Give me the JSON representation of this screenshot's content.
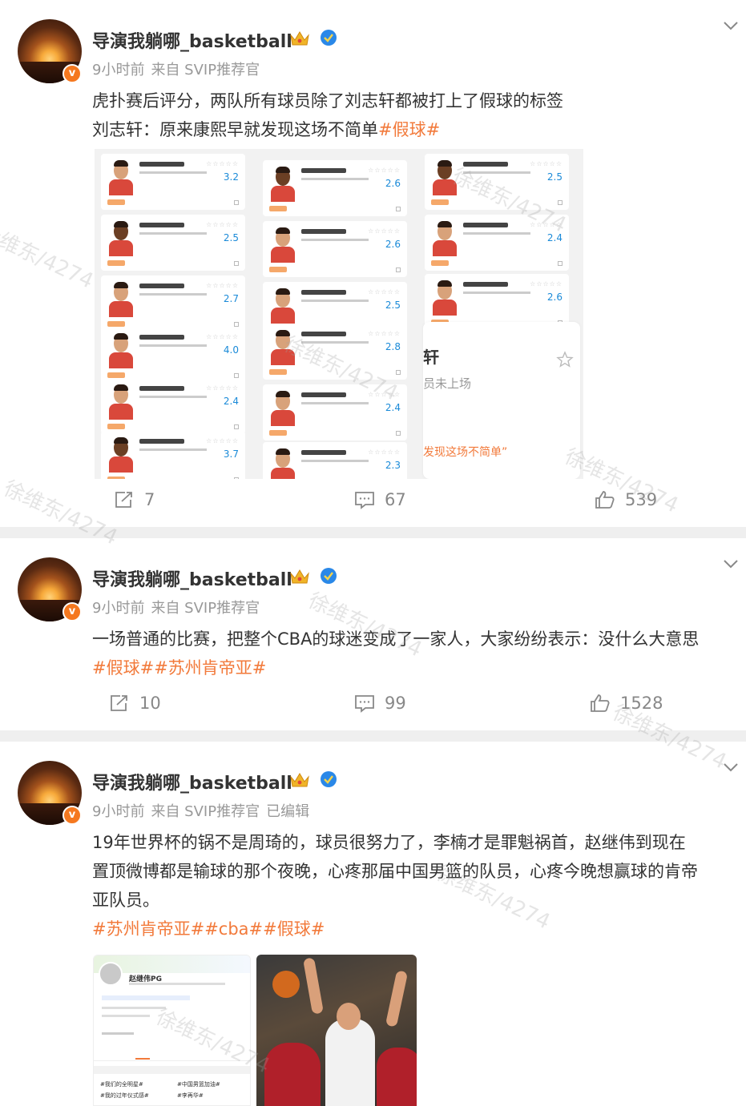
{
  "posts": [
    {
      "username": "导演我躺哪_basketball",
      "time": "9小时前",
      "source": "来自 SVIP推荐官",
      "edited": "",
      "text_lines": [
        "虎扑赛后评分，两队所有球员除了刘志轩都被打上了假球的标签"
      ],
      "line2_prefix": "刘志轩：原来康熙早就发现这场不简单",
      "line2_tag": "#假球#",
      "image": {
        "overlay_title": "轩",
        "overlay_subtitle": "员未上场",
        "overlay_quote": "发现这场不简单”",
        "scores": [
          [
            "3.2",
            "2.5",
            "2.7",
            "4.0",
            "2.4",
            "3.7"
          ],
          [
            "2.6",
            "2.6",
            "2.5",
            "2.8",
            "2.4",
            "2.3"
          ],
          [
            "2.5",
            "2.4",
            "2.6"
          ]
        ]
      },
      "actions": {
        "share": "7",
        "comment": "67",
        "like": "539"
      }
    },
    {
      "username": "导演我躺哪_basketball",
      "time": "9小时前",
      "source": "来自 SVIP推荐官",
      "edited": "",
      "text_lines": [
        "一场普通的比赛，把整个CBA的球迷变成了一家人，大家纷纷表示：没什么大意思"
      ],
      "tags_line": "#假球##苏州肯帝亚#",
      "actions": {
        "share": "10",
        "comment": "99",
        "like": "1528"
      }
    },
    {
      "username": "导演我躺哪_basketball",
      "time": "9小时前",
      "source": "来自 SVIP推荐官",
      "edited": "已编辑",
      "text_lines": [
        "19年世界杯的锅不是周琦的，球员很努力了，李楠才是罪魁祸首，赵继伟到现在",
        "置顶微博都是输球的那个夜晚，心疼那届中国男篮的队员，心疼今晚想赢球的肯帝",
        "亚队员。"
      ],
      "tags_line": "#苏州肯帝亚##cba##假球#",
      "image1": {
        "profile_name": "赵继伟PG",
        "tag_a": "#我们的全明星#",
        "tag_b": "#中国男篮加油#",
        "tag_c": "#我的过年仪式感#",
        "tag_d": "#李再华#"
      }
    }
  ],
  "watermark": "徐维东/4274",
  "colors": {
    "accent": "#f27a3b",
    "meta": "#999999",
    "divider": "#efefef",
    "score": "#1a8ad8"
  },
  "icons": [
    "avatar-v-badge",
    "crown-icon",
    "verify-icon",
    "chevron-down-icon",
    "share-icon",
    "comment-icon",
    "like-icon",
    "star-icon"
  ]
}
